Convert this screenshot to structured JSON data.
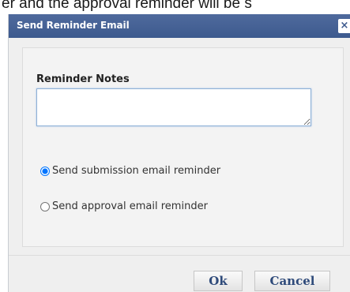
{
  "background": {
    "partial_text": "er and the approval reminder will be s"
  },
  "dialog": {
    "title": "Send Reminder Email",
    "close_label": "×",
    "notes_label": "Reminder Notes",
    "notes_value": "",
    "radio_options": [
      {
        "label": "Send submission email reminder",
        "checked": true
      },
      {
        "label": "Send approval email reminder",
        "checked": false
      }
    ],
    "ok_label": "Ok",
    "cancel_label": "Cancel"
  },
  "colors": {
    "titlebar": "#3d5a8e",
    "button_text": "#2e4a7a",
    "dialog_bg": "#efefef"
  }
}
